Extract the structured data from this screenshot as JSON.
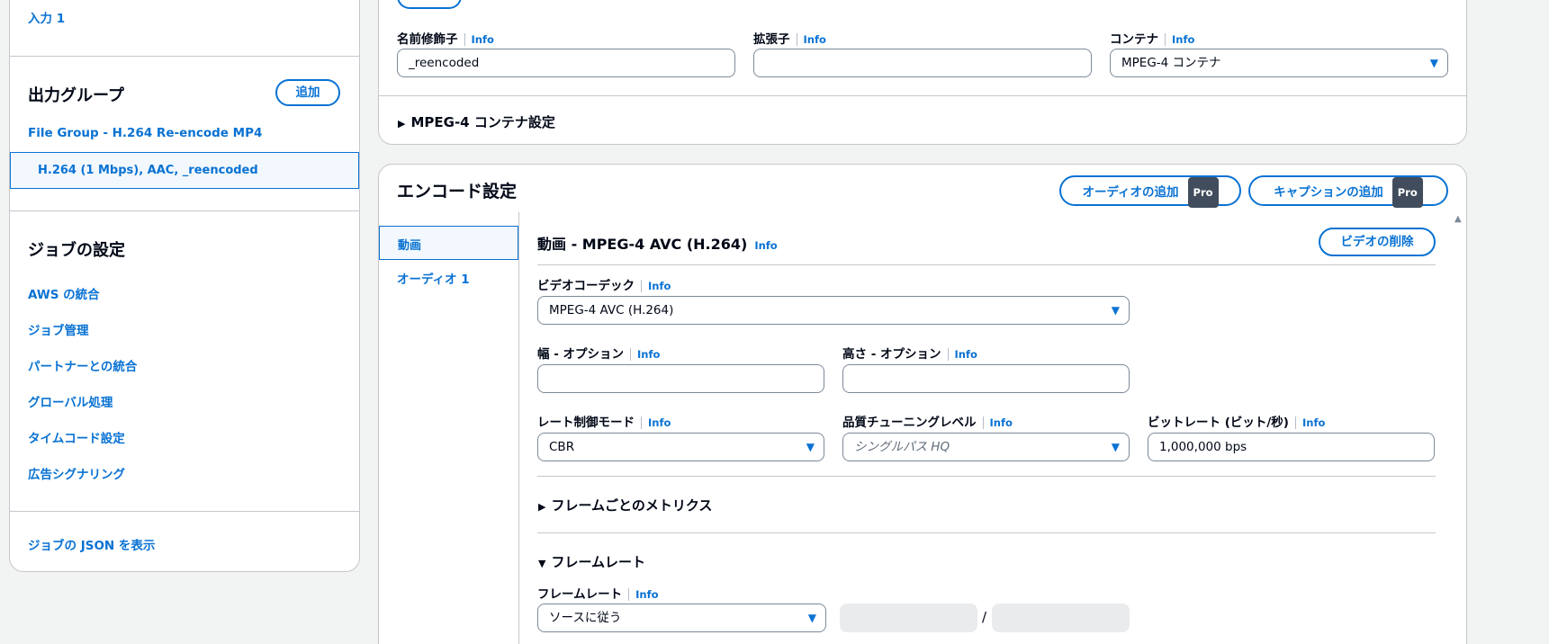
{
  "sidebar": {
    "input_link": "入力 1",
    "output_groups_title": "出力グループ",
    "add_button": "追加",
    "file_group_link": "File Group - H.264 Re-encode MP4",
    "selected_output": "H.264 (1 Mbps), AAC, _reencoded",
    "job_settings_title": "ジョブの設定",
    "job_settings_items": [
      "AWS の統合",
      "ジョブ管理",
      "パートナーとの統合",
      "グローバル処理",
      "タイムコード設定",
      "広告シグナリング"
    ],
    "show_json_link": "ジョブの JSON を表示"
  },
  "output_settings": {
    "name_modifier_label": "名前修飾子",
    "name_modifier_value": "_reencoded",
    "extension_label": "拡張子",
    "extension_value": "",
    "container_label": "コンテナ",
    "container_value": "MPEG-4 コンテナ",
    "info": "Info",
    "container_settings_toggle": "MPEG-4 コンテナ設定"
  },
  "encode": {
    "title": "エンコード設定",
    "add_audio_button": "オーディオの追加",
    "add_caption_button": "キャプションの追加",
    "pro_badge": "Pro",
    "tabs": [
      "動画",
      "オーディオ 1"
    ],
    "video_section_title": "動画 - MPEG-4 AVC (H.264)",
    "delete_video_button": "ビデオの削除",
    "codec_label": "ビデオコーデック",
    "codec_value": "MPEG-4 AVC (H.264)",
    "width_label": "幅 - オプション",
    "width_value": "",
    "height_label": "高さ - オプション",
    "height_value": "",
    "rate_control_label": "レート制御モード",
    "rate_control_value": "CBR",
    "quality_tuning_label": "品質チューニングレベル",
    "quality_tuning_placeholder": "シングルパス HQ",
    "bitrate_label": "ビットレート (ビット/秒)",
    "bitrate_value": "1,000,000 bps",
    "per_frame_metrics_toggle": "フレームごとのメトリクス",
    "framerate_section_toggle": "フレームレート",
    "framerate_label": "フレームレート",
    "framerate_value": "ソースに従う",
    "framerate_separator": "/"
  },
  "colors": {
    "accent": "#0972d3",
    "text": "#000716",
    "border": "#c6c6cd",
    "selected_bg": "#f2f8fd"
  },
  "icons": {
    "expand": "caret-right-icon",
    "collapse": "caret-down-icon",
    "dropdown": "caret-down-icon",
    "scroll": "scroll-up-icon"
  }
}
